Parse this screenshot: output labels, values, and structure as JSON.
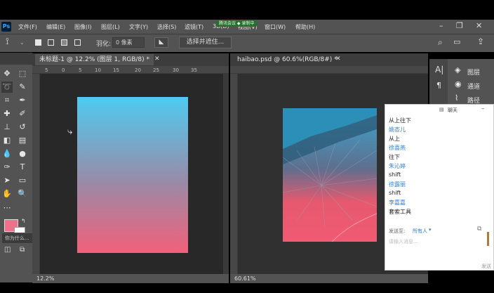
{
  "app": {
    "logo": "Ps",
    "menu": [
      "文件(F)",
      "编辑(E)",
      "图像(I)",
      "图层(L)",
      "文字(Y)",
      "选择(S)",
      "滤镜(T)",
      "3D(D)",
      "视图(V)",
      "窗口(W)",
      "帮助(H)"
    ],
    "meeting_banner": "腾讯会议 ◆ 录制中"
  },
  "options": {
    "feather_label": "羽化:",
    "feather_value": "0 像素",
    "select_mask_button": "选择并遮住..."
  },
  "docs": [
    {
      "tab": "未标题-1 @ 12.2% (图层 1, RGB/8) *",
      "zoom": "12.2%",
      "ruler_ticks": [
        "5",
        "0",
        "5",
        "10",
        "15",
        "20",
        "25",
        "30",
        "35"
      ],
      "gradient_top": "#4ecbf0",
      "gradient_bottom": "#f2607a"
    },
    {
      "tab": "haibao.psd @ 60.6%(RGB/8#) *",
      "zoom": "60.61%"
    }
  ],
  "tools_tooltip": "你为什么...",
  "panels": [
    {
      "icon": "layers-icon",
      "label": "图层"
    },
    {
      "icon": "channels-icon",
      "label": "通道"
    },
    {
      "icon": "paths-icon",
      "label": "路径"
    }
  ],
  "chat": {
    "title": "聊天",
    "messages": [
      {
        "type": "msg",
        "text": "从上往下"
      },
      {
        "type": "name",
        "text": "姚杏儿"
      },
      {
        "type": "msg",
        "text": "从上"
      },
      {
        "type": "name",
        "text": "徐喜燕"
      },
      {
        "type": "msg",
        "text": "往下"
      },
      {
        "type": "name",
        "text": "朱沁婷"
      },
      {
        "type": "msg",
        "text": "shift"
      },
      {
        "type": "name",
        "text": "徐露丽"
      },
      {
        "type": "msg",
        "text": "shift"
      },
      {
        "type": "name",
        "text": "李嘉嘉"
      },
      {
        "type": "msg",
        "text": "套索工具"
      }
    ],
    "send_to_label": "发送至:",
    "send_to_value": "所有人",
    "input_placeholder": "请输入消息...",
    "send_button": "发送"
  },
  "colors": {
    "foreground": "#f07088",
    "background": "#ffffff"
  }
}
